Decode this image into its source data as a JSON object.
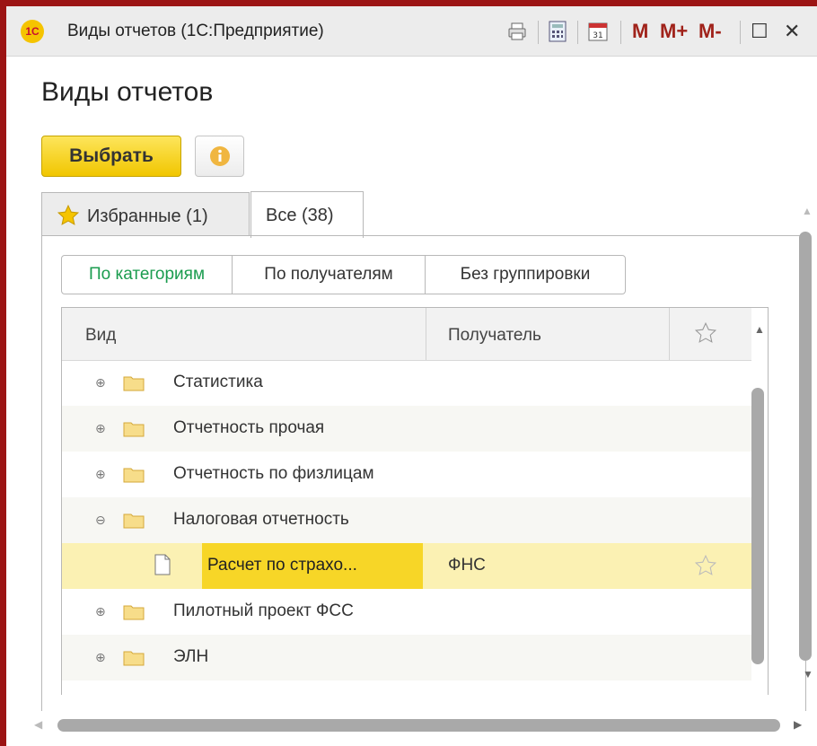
{
  "window": {
    "title": "Виды отчетов  (1С:Предприятие)",
    "logo_text": "1С",
    "toolbar": {
      "m_label": "M",
      "m_plus_label": "M+",
      "m_minus_label": "M-",
      "maximize_glyph": "☐",
      "close_glyph": "✕"
    }
  },
  "form": {
    "title": "Виды отчетов",
    "select_button": "Выбрать"
  },
  "tabs": [
    {
      "label": "Избранные (1)",
      "active": false
    },
    {
      "label": "Все (38)",
      "active": true
    }
  ],
  "grouping": {
    "options": [
      "По категориям",
      "По получателям",
      "Без группировки"
    ],
    "active": "По категориям",
    "active_color": "#1b9c4f"
  },
  "table": {
    "columns": {
      "kind": "Вид",
      "recipient": "Получатель"
    },
    "rows": [
      {
        "name": "Статистика",
        "expander": "⊕",
        "type": "folder"
      },
      {
        "name": "Отчетность прочая",
        "expander": "⊕",
        "type": "folder"
      },
      {
        "name": "Отчетность по физлицам",
        "expander": "⊕",
        "type": "folder"
      },
      {
        "name": "Налоговая отчетность",
        "expander": "⊖",
        "type": "folder"
      },
      {
        "name": "Расчет по страхо...",
        "type": "document",
        "recipient": "ФНС",
        "selected": true
      },
      {
        "name": "Пилотный проект ФСС",
        "expander": "⊕",
        "type": "folder"
      },
      {
        "name": "ЭЛН",
        "expander": "⊕",
        "type": "folder"
      }
    ]
  },
  "colors": {
    "accent_yellow": "#f7d627",
    "selected_row": "#fbf1b3",
    "window_frame": "#9c1414",
    "button_yellow": "#f1c600"
  }
}
